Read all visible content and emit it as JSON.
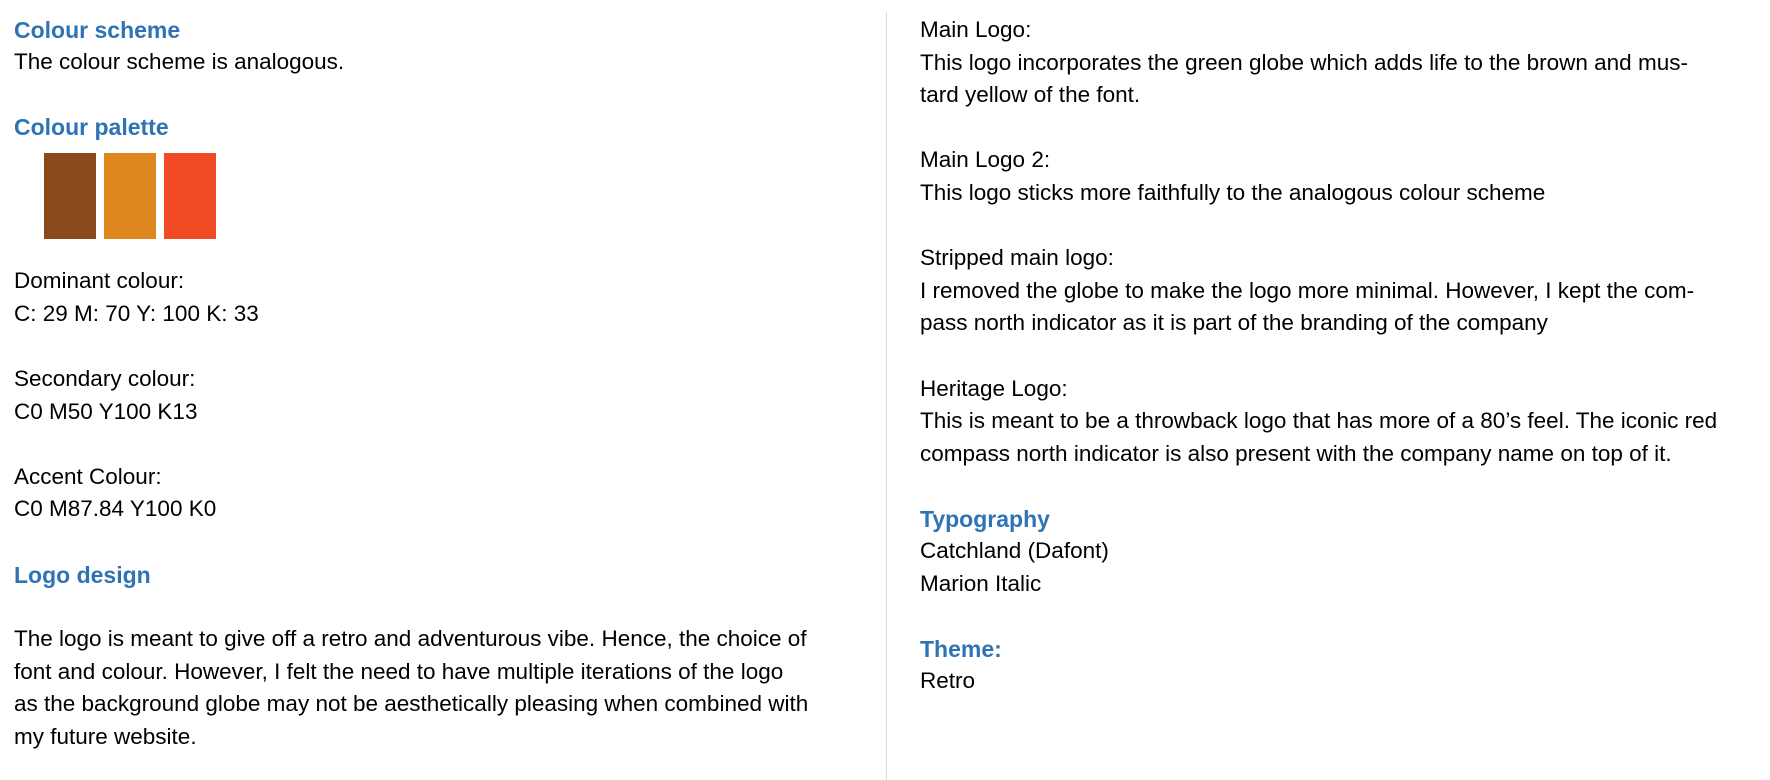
{
  "colors": {
    "heading": "#2e74b5",
    "text": "#000000",
    "divider": "#d9d9d9"
  },
  "left": {
    "colour_scheme": {
      "heading": "Colour scheme",
      "text": "The colour scheme is analogous."
    },
    "colour_palette": {
      "heading": "Colour palette",
      "swatches": [
        {
          "name": "dominant",
          "color": "#8b4a1c"
        },
        {
          "name": "secondary",
          "color": "#de871f"
        },
        {
          "name": "accent",
          "color": "#f04b24"
        }
      ]
    },
    "dominant": {
      "label": "Dominant colour:",
      "value": "C: 29 M: 70 Y: 100 K: 33"
    },
    "secondary": {
      "label": "Secondary colour:",
      "value": "C0 M50 Y100 K13"
    },
    "accent": {
      "label": "Accent Colour:",
      "value": "C0 M87.84 Y100 K0"
    },
    "logo_design": {
      "heading": "Logo design",
      "paragraph_lines": [
        "The logo is meant to give off a retro and adventurous vibe. Hence, the choice of",
        "font and colour. However, I felt the need to have multiple iterations of the logo",
        "as the background globe may not be aesthetically pleasing when combined with",
        "my future website."
      ]
    }
  },
  "right": {
    "main_logo": {
      "label": "Main Logo:",
      "lines": [
        "This logo incorporates the green globe which adds life to the brown and mus-",
        "tard yellow of the font."
      ]
    },
    "main_logo_2": {
      "label": "Main Logo 2:",
      "lines": [
        "This logo sticks more faithfully to the analogous colour scheme"
      ]
    },
    "stripped_logo": {
      "label": "Stripped main logo:",
      "lines": [
        "I removed the globe to make the logo more minimal. However, I kept the com-",
        "pass north indicator as it is part of the branding of the company"
      ]
    },
    "heritage_logo": {
      "label": "Heritage Logo:",
      "lines": [
        "This is meant to be a throwback logo that has more of a 80’s feel. The iconic red",
        "compass north indicator is also present with the company name on top of it."
      ]
    },
    "typography": {
      "heading": "Typography",
      "fonts": [
        "Catchland (Dafont)",
        "Marion Italic"
      ]
    },
    "theme": {
      "heading": "Theme:",
      "value": "Retro"
    }
  }
}
